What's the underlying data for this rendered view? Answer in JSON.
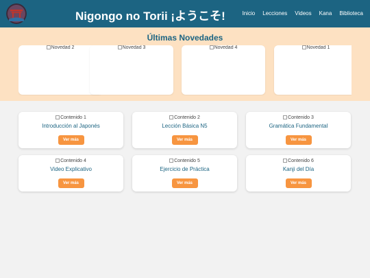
{
  "header": {
    "title": "Nigongo no Torii ¡ようこそ!",
    "nav": [
      "Inicio",
      "Lecciones",
      "Videos",
      "Kana",
      "Biblioteca"
    ]
  },
  "news": {
    "title": "Últimas Novedades",
    "items": [
      {
        "alt": "Novedad 2"
      },
      {
        "alt": "Novedad 3"
      },
      {
        "alt": "Novedad 4"
      },
      {
        "alt": "Novedad 1"
      }
    ]
  },
  "contents": [
    {
      "alt": "Contenido 1",
      "title": "Introducción al Japonés",
      "button": "Ver más"
    },
    {
      "alt": "Contenido 2",
      "title": "Lección Básica N5",
      "button": "Ver más"
    },
    {
      "alt": "Contenido 3",
      "title": "Gramática Fundamental",
      "button": "Ver más"
    },
    {
      "alt": "Contenido 4",
      "title": "Video Explicativo",
      "button": "Ver más"
    },
    {
      "alt": "Contenido 5",
      "title": "Ejercicio de Práctica",
      "button": "Ver más"
    },
    {
      "alt": "Contenido 6",
      "title": "Kanji del Día",
      "button": "Ver más"
    }
  ],
  "colors": {
    "header_bg": "#1c6482",
    "news_bg": "#fde1c2",
    "accent_button": "#f79540",
    "title_text": "#1c6482"
  }
}
